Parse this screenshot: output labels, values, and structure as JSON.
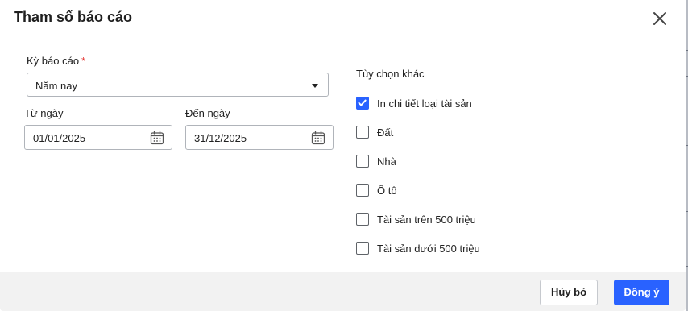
{
  "dialog": {
    "title": "Tham số báo cáo",
    "close_icon": "close-icon"
  },
  "report_period": {
    "label": "Kỳ báo cáo",
    "required_mark": "*",
    "selected": "Năm nay"
  },
  "from_date": {
    "label": "Từ ngày",
    "value": "01/01/2025"
  },
  "to_date": {
    "label": "Đến ngày",
    "value": "31/12/2025"
  },
  "other_options": {
    "label": "Tùy chọn khác",
    "items": [
      {
        "label": "In chi tiết loại tài sản",
        "checked": true
      },
      {
        "label": "Đất",
        "checked": false
      },
      {
        "label": "Nhà",
        "checked": false
      },
      {
        "label": "Ô tô",
        "checked": false
      },
      {
        "label": "Tài sản trên 500 triệu",
        "checked": false
      },
      {
        "label": "Tài sản dưới 500 triệu",
        "checked": false
      }
    ]
  },
  "buttons": {
    "cancel": "Hủy bỏ",
    "ok": "Đồng ý"
  },
  "colors": {
    "accent": "#2962ff",
    "required": "#e53935",
    "footer_bg": "#f2f2f2"
  }
}
